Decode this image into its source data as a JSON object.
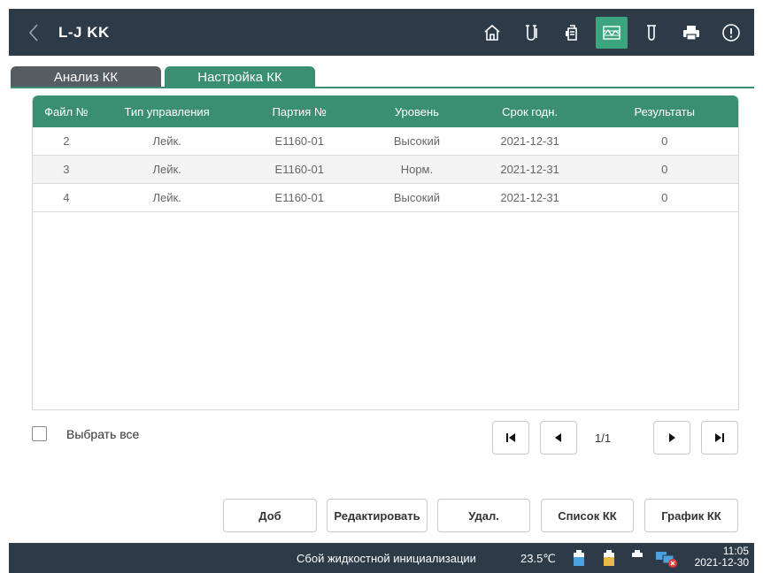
{
  "header": {
    "title": "L-J KK",
    "icons": [
      "home-icon",
      "test-tube-icon",
      "reagent-icon",
      "qc-icon",
      "sample-tube-icon",
      "printer-icon",
      "alert-icon"
    ],
    "active_icon": "qc-icon",
    "accent": "#3aa57e"
  },
  "tabs": [
    {
      "label": "Анализ КК",
      "active": false
    },
    {
      "label": "Настройка КК",
      "active": true
    }
  ],
  "table": {
    "headers": [
      "Файл №",
      "Тип управления",
      "Партия №",
      "Уровень",
      "Срок годн.",
      "Результаты"
    ],
    "rows": [
      {
        "file": "2",
        "type": "Лейк.",
        "lot": "E1160-01",
        "level": "Высокий",
        "expiry": "2021-12-31",
        "results": "0"
      },
      {
        "file": "3",
        "type": "Лейк.",
        "lot": "E1160-01",
        "level": "Норм.",
        "expiry": "2021-12-31",
        "results": "0"
      },
      {
        "file": "4",
        "type": "Лейк.",
        "lot": "E1160-01",
        "level": "Высокий",
        "expiry": "2021-12-31",
        "results": "0"
      }
    ]
  },
  "select_all": {
    "label": "Выбрать все",
    "checked": false
  },
  "pagination": {
    "page_info": "1/1"
  },
  "buttons": {
    "add": "Доб",
    "edit": "Редактировать",
    "delete": "Удал.",
    "qc_list": "Список КК",
    "qc_chart": "График КК"
  },
  "status": {
    "message": "Сбой жидкостной инициализации",
    "temperature": "23.5℃",
    "time": "11:05",
    "date": "2021-12-30"
  },
  "colors": {
    "header_bg": "#2d3a48",
    "table_header": "#3a8f73",
    "tab_inactive": "#555c62"
  }
}
